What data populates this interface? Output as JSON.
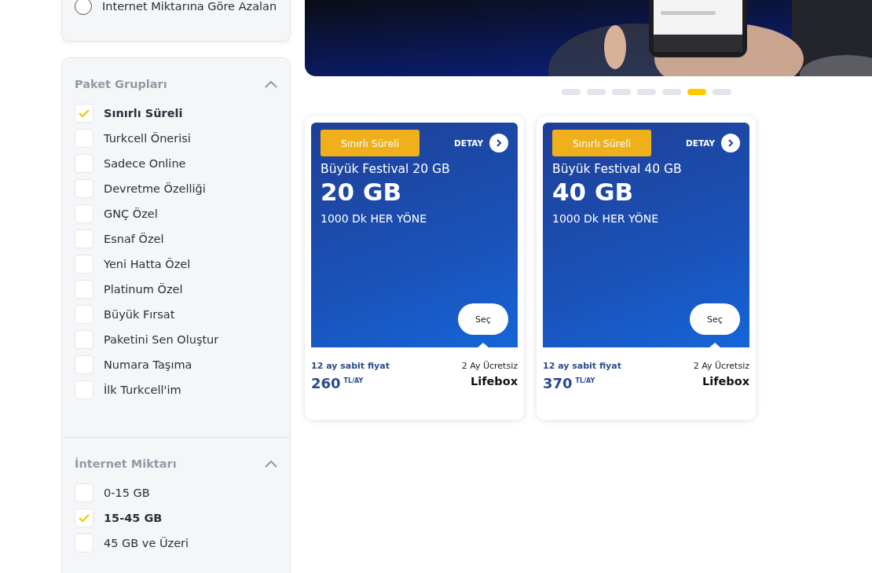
{
  "sort_options": [
    {
      "label": "Internet Miktarına Göre Azalan",
      "selected": false
    }
  ],
  "filter_groups": [
    {
      "title": "Paket Grupları",
      "expanded": true,
      "options": [
        {
          "label": "Sınırlı Süreli",
          "checked": true
        },
        {
          "label": "Turkcell Önerisi",
          "checked": false
        },
        {
          "label": "Sadece Online",
          "checked": false
        },
        {
          "label": "Devretme Özelliği",
          "checked": false
        },
        {
          "label": "GNÇ Özel",
          "checked": false
        },
        {
          "label": "Esnaf Özel",
          "checked": false
        },
        {
          "label": "Yeni Hatta Özel",
          "checked": false
        },
        {
          "label": "Platinum Özel",
          "checked": false
        },
        {
          "label": "Büyük Fırsat",
          "checked": false
        },
        {
          "label": "Paketini Sen Oluştur",
          "checked": false
        },
        {
          "label": "Numara Taşıma",
          "checked": false
        },
        {
          "label": "İlk Turkcell'im",
          "checked": false
        }
      ]
    },
    {
      "title": "İnternet Miktarı",
      "expanded": true,
      "options": [
        {
          "label": "0-15 GB",
          "checked": false
        },
        {
          "label": "15-45 GB",
          "checked": true
        },
        {
          "label": "45 GB ve Üzeri",
          "checked": false
        }
      ]
    }
  ],
  "carousel_dots": [
    {
      "selected": false
    },
    {
      "selected": false
    },
    {
      "selected": false
    },
    {
      "selected": false
    },
    {
      "selected": false
    },
    {
      "selected": true
    },
    {
      "selected": false
    }
  ],
  "packages": [
    {
      "tag": "Sınırlı Süreli",
      "detail": "DETAY",
      "name": "Büyük Festival 20 GB",
      "data": "20 GB",
      "minutes": "1000 Dk HER YÖNE",
      "select": "Seç",
      "price_note": "12 ay sabit fiyat",
      "price": "260",
      "price_unit": "TL/AY",
      "bonus_note": "2 Ay Ücretsiz",
      "bonus": "Lifebox"
    },
    {
      "tag": "Sınırlı Süreli",
      "detail": "DETAY",
      "name": "Büyük Festival 40 GB",
      "data": "40 GB",
      "minutes": "1000 Dk HER YÖNE",
      "select": "Seç",
      "price_note": "12 ay sabit fiyat",
      "price": "370",
      "price_unit": "TL/AY",
      "bonus_note": "2 Ay Ücretsiz",
      "bonus": "Lifebox"
    }
  ]
}
